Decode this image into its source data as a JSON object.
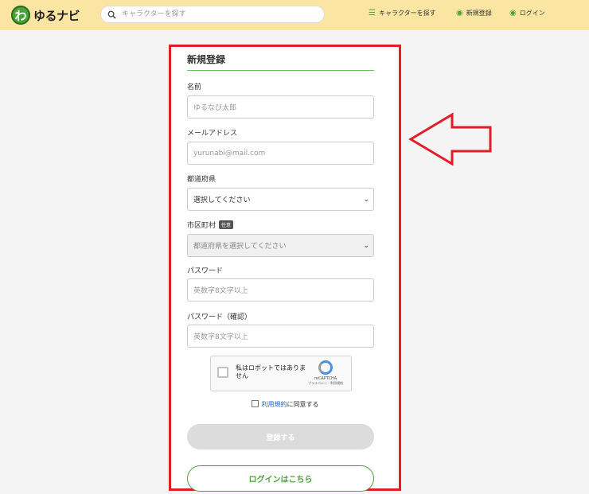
{
  "header": {
    "logo_mark": "わ",
    "logo_text": "ゆるナビ",
    "search_placeholder": "キャラクターを探す",
    "nav": [
      {
        "label": "キャラクターを探す",
        "icon": "list-icon"
      },
      {
        "label": "新規登録",
        "icon": "user-circle-icon"
      },
      {
        "label": "ログイン",
        "icon": "user-circle-icon"
      }
    ]
  },
  "form": {
    "title": "新規登録",
    "name_label": "名前",
    "name_placeholder": "ゆるなび太郎",
    "email_label": "メールアドレス",
    "email_placeholder": "yurunabi@mail.com",
    "pref_label": "都道府県",
    "pref_value": "選択してください",
    "city_label": "市区町村",
    "city_badge": "任意",
    "city_value": "都道府県を選択してください",
    "password_label": "パスワード",
    "password_placeholder": "英数字8文字以上",
    "password_confirm_label": "パスワード（確認）",
    "password_confirm_placeholder": "英数字8文字以上",
    "captcha_text": "私はロボットではありません",
    "captcha_brand": "reCAPTCHA",
    "captcha_links": "プライバシー・利用規約",
    "terms_link": "利用規約",
    "terms_text": "に同意する",
    "submit_label": "登録する",
    "login_label": "ログインはこちら"
  },
  "colors": {
    "header_bg": "#fbe5a3",
    "accent_green": "#4ba238",
    "highlight_red": "#e21c28"
  }
}
